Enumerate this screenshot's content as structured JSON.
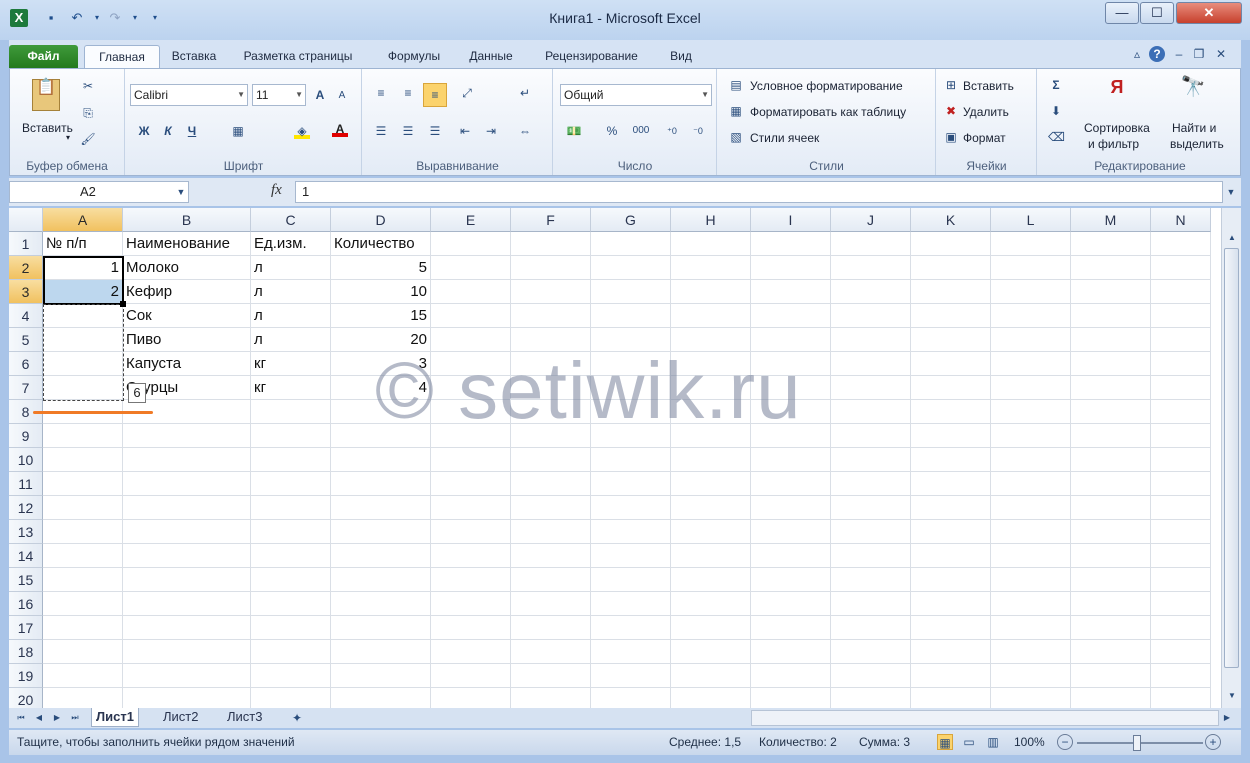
{
  "window": {
    "title": "Книга1 - Microsoft Excel",
    "minimize": "—",
    "maximize": "☐",
    "close": "✕"
  },
  "ribbon_tabs": [
    "Файл",
    "Главная",
    "Вставка",
    "Разметка страницы",
    "Формулы",
    "Данные",
    "Рецензирование",
    "Вид"
  ],
  "ribbon": {
    "clipboard": {
      "paste": "Вставить",
      "label": "Буфер обмена"
    },
    "font": {
      "name": "Calibri",
      "size": "11",
      "bold": "Ж",
      "italic": "К",
      "underline": "Ч",
      "label": "Шрифт"
    },
    "alignment": {
      "label": "Выравнивание"
    },
    "number": {
      "format": "Общий",
      "percent": "%",
      "thousands": "000",
      "label": "Число"
    },
    "styles": {
      "conditional": "Условное форматирование",
      "as_table": "Форматировать как таблицу",
      "cell_styles": "Стили ячеек",
      "label": "Стили"
    },
    "cells": {
      "insert": "Вставить",
      "delete": "Удалить",
      "format": "Формат",
      "label": "Ячейки"
    },
    "editing": {
      "sort1": "Сортировка",
      "sort2": "и фильтр",
      "find1": "Найти и",
      "find2": "выделить",
      "label": "Редактирование"
    }
  },
  "formula_bar": {
    "name_box": "A2",
    "fx": "fx",
    "value": "1"
  },
  "columns": [
    "A",
    "B",
    "C",
    "D",
    "E",
    "F",
    "G",
    "H",
    "I",
    "J",
    "K",
    "L",
    "M",
    "N"
  ],
  "rows": [
    "1",
    "2",
    "3",
    "4",
    "5",
    "6",
    "7",
    "8",
    "9",
    "10",
    "11",
    "12",
    "13",
    "14",
    "15",
    "16",
    "17",
    "18",
    "19",
    "20"
  ],
  "table": {
    "headers": [
      "№ п/п",
      "Наименование",
      "Ед.изм.",
      "Количество"
    ],
    "rows": [
      [
        "1",
        "Молоко",
        "л",
        "5"
      ],
      [
        "2",
        "Кефир",
        "л",
        "10"
      ],
      [
        "",
        "Сок",
        "л",
        "15"
      ],
      [
        "",
        "Пиво",
        "л",
        "20"
      ],
      [
        "",
        "Капуста",
        "кг",
        "3"
      ],
      [
        "",
        "Огурцы",
        "кг",
        "4"
      ]
    ]
  },
  "fill_tooltip": "6",
  "watermark": "© setiwik.ru",
  "sheet_tabs": [
    "Лист1",
    "Лист2",
    "Лист3"
  ],
  "status": {
    "message": "Тащите, чтобы заполнить ячейки рядом значений",
    "average": "Среднее: 1,5",
    "count": "Количество: 2",
    "sum": "Сумма: 3",
    "zoom": "100%"
  },
  "colors": {
    "selection_header": "#f1c15f",
    "file_tab": "#237a1d",
    "underline_marker": "#f07a26"
  }
}
